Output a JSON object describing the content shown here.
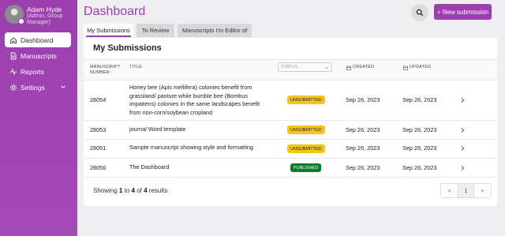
{
  "user": {
    "name": "Adam Hyde",
    "role": "(Admin, Group Manager)"
  },
  "sidebar": {
    "items": [
      {
        "label": "Dashboard",
        "icon": "home-icon",
        "active": true
      },
      {
        "label": "Manuscripts",
        "icon": "document-icon"
      },
      {
        "label": "Reports",
        "icon": "activity-icon"
      },
      {
        "label": "Settings",
        "icon": "gear-icon",
        "expandable": true
      }
    ]
  },
  "header": {
    "title": "Dashboard",
    "new_button": "+ New submission",
    "search_icon": "search-icon"
  },
  "tabs": [
    {
      "label": "My Submissions",
      "active": true
    },
    {
      "label": "To Review"
    },
    {
      "label": "Manuscripts I'm Editor of"
    }
  ],
  "table": {
    "heading": "My Submissions",
    "columns": {
      "number_line1": "MANUSCRIPT",
      "number_line2": "NUMBER",
      "title": "TITLE",
      "status_placeholder": "STATUS",
      "created": "CREATED",
      "updated": "UPDATED"
    },
    "rows": [
      {
        "number": "28054",
        "title": "Honey bee (Apis mellifera) colonies benefit from grassland/ pasture while bumble bee (Bombus impatiens) colonies in the same landscapes benefit from non-corn/soybean cropland",
        "status": "UNSUBMITTED",
        "created": "Sep 26, 2023",
        "updated": "Sep 26, 2023"
      },
      {
        "number": "28053",
        "title": "journal Word template",
        "status": "UNSUBMITTED",
        "created": "Sep 26, 2023",
        "updated": "Sep 26, 2023"
      },
      {
        "number": "28051",
        "title": "Sample manuscript showing style and formatting",
        "status": "UNSUBMITTED",
        "created": "Sep 26, 2023",
        "updated": "Sep 26, 2023"
      },
      {
        "number": "28050",
        "title": "The Dashboard",
        "status": "PUBLISHED",
        "created": "Sep 26, 2023",
        "updated": "Sep 26, 2023"
      }
    ]
  },
  "footer": {
    "showing": "Showing",
    "from": "1",
    "to_word": "to",
    "to": "4",
    "of_word": "of",
    "total": "4",
    "results_word": "results"
  },
  "pagination": {
    "prev": "<",
    "current": "1",
    "next": ">"
  },
  "colors": {
    "accent": "#9b3fae",
    "unsubmitted": "#f5c518",
    "published": "#0c7c2e"
  }
}
